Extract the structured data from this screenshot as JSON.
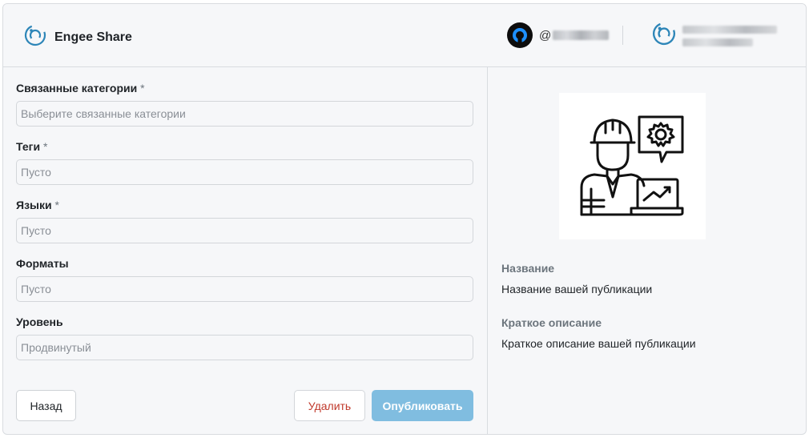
{
  "header": {
    "brand": "Engee Share",
    "user_handle_prefix": "@",
    "icons": {
      "brand": "engee-logo-icon",
      "avatar": "user-avatar-icon",
      "org": "engee-org-logo-icon"
    },
    "accent": "#2e86b8"
  },
  "form": {
    "fields": [
      {
        "label": "Связанные категории",
        "required": "*",
        "placeholder": "Выберите связанные категории"
      },
      {
        "label": "Теги",
        "required": "*",
        "placeholder": "Пусто"
      },
      {
        "label": "Языки",
        "required": "*",
        "placeholder": "Пусто"
      },
      {
        "label": "Форматы",
        "required": "",
        "placeholder": "Пусто"
      },
      {
        "label": "Уровень",
        "required": "",
        "value": "Продвинутый"
      }
    ],
    "buttons": {
      "back": "Назад",
      "delete": "Удалить",
      "publish": "Опубликовать"
    }
  },
  "preview": {
    "image_icon": "engineer-laptop-illustration",
    "title_label": "Название",
    "title_value": "Название вашей публикации",
    "desc_label": "Краткое описание",
    "desc_value": "Краткое описание вашей публикации"
  },
  "colors": {
    "publish_bg": "#80bde0",
    "delete_text": "#c0392b",
    "background": "#f6f7f9"
  }
}
